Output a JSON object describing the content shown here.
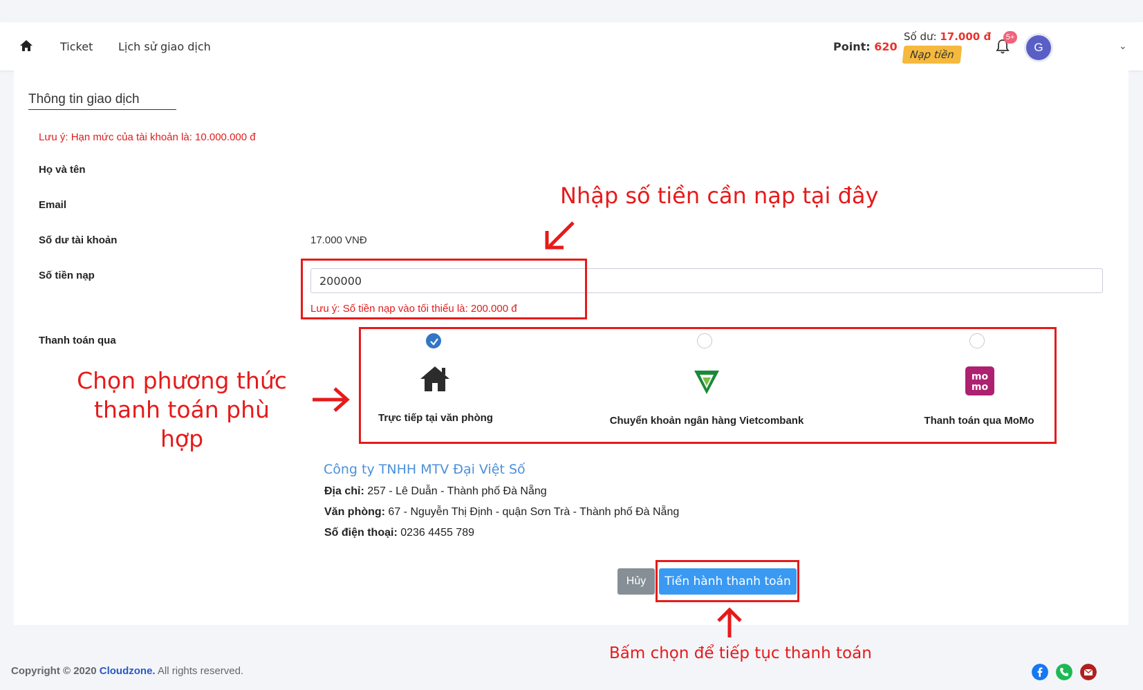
{
  "nav": {
    "home_icon": "home-icon",
    "links": [
      "Ticket",
      "Lịch sử giao dịch"
    ],
    "point_label": "Point:",
    "point_value": "620",
    "balance_label": "Số dư:",
    "balance_value": "17.000 đ",
    "topup_label": "Nạp tiền",
    "notification_badge": "5+",
    "avatar_initial": "G",
    "dropdown_icon": "chevron-down-icon"
  },
  "form": {
    "title": "Thông tin giao dịch",
    "limit_note": "Lưu ý: Hạn mức của tài khoản là: 10.000.000 đ",
    "fullname_label": "Họ và tên",
    "email_label": "Email",
    "balance_label": "Số dư tài khoản",
    "balance_value": "17.000 VNĐ",
    "amount_label": "Số tiền nạp",
    "amount_value": "200000",
    "amount_note": "Lưu ý: Số tiền nạp vào tối thiểu là: 200.000 đ",
    "payment_label": "Thanh toán qua"
  },
  "payment_methods": [
    {
      "label": "Trực tiếp tại văn phòng",
      "icon": "office-home-icon",
      "selected": true
    },
    {
      "label": "Chuyển khoản ngân hàng Vietcombank",
      "icon": "vietcombank-logo-icon",
      "selected": false
    },
    {
      "label": "Thanh toán qua MoMo",
      "icon": "momo-logo-icon",
      "selected": false
    }
  ],
  "office_info": {
    "company": "Công ty TNHH MTV Đại Việt Số",
    "address_label": "Địa chỉ:",
    "address_value": " 257 - Lê Duẫn - Thành phố Đà Nẵng",
    "office_label": "Văn phòng:",
    "office_value": " 67 - Nguyễn Thị Định - quận Sơn Trà - Thành phố Đà Nẵng",
    "phone_label": "Số điện thoại:",
    "phone_value": " 0236 4455 789"
  },
  "actions": {
    "cancel_label": "Hủy",
    "pay_label": "Tiến hành thanh toán"
  },
  "annotations": {
    "amount_hint": "Nhập số tiền cần nạp tại đây",
    "method_hint_line1": "Chọn phương thức",
    "method_hint_line2": "thanh toán phù hợp",
    "pay_hint": "Bấm chọn để tiếp tục thanh toán"
  },
  "footer": {
    "copyright_prefix": "Copyright © 2020 ",
    "brand": "Cloudzone.",
    "rights": " All rights reserved.",
    "social_icons": [
      "facebook-icon",
      "phone-icon",
      "mail-icon"
    ]
  },
  "colors": {
    "accent_red": "#e61a1a",
    "primary_blue": "#3a99f2",
    "topup_yellow": "#f5b93e"
  }
}
